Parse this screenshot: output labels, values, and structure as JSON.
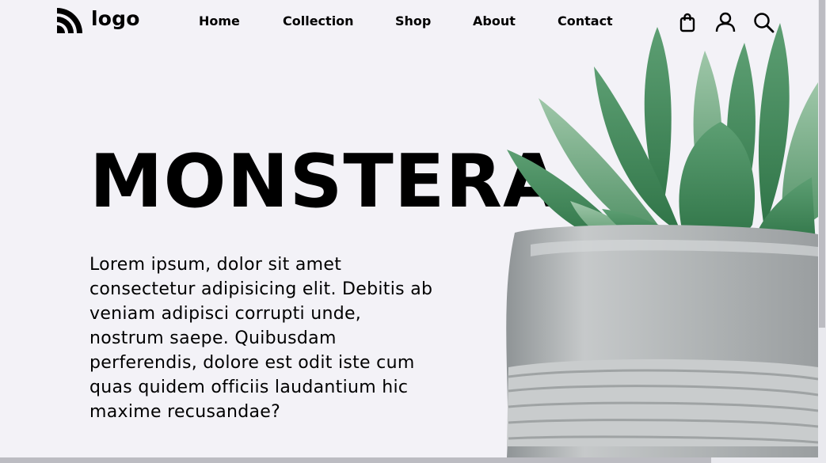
{
  "brand": {
    "logo_text": "logo"
  },
  "nav": {
    "items": [
      {
        "label": "Home"
      },
      {
        "label": "Collection"
      },
      {
        "label": "Shop"
      },
      {
        "label": "About"
      },
      {
        "label": "Contact"
      }
    ]
  },
  "header_icons": [
    "shopping-bag-icon",
    "user-icon",
    "search-icon"
  ],
  "hero": {
    "title": "MONSTERA",
    "description": "Lorem ipsum, dolor sit amet consectetur adipisicing elit. Debitis ab veniam adipisci corrupti unde, nostrum saepe. Quibusdam perferendis, dolore est odit iste cum quas quidem officiis laudantium hic maxime recusandae?"
  },
  "colors": {
    "background": "#f3f2f7",
    "leaf": "#3d8a56",
    "pot": "#b7bbbc"
  }
}
